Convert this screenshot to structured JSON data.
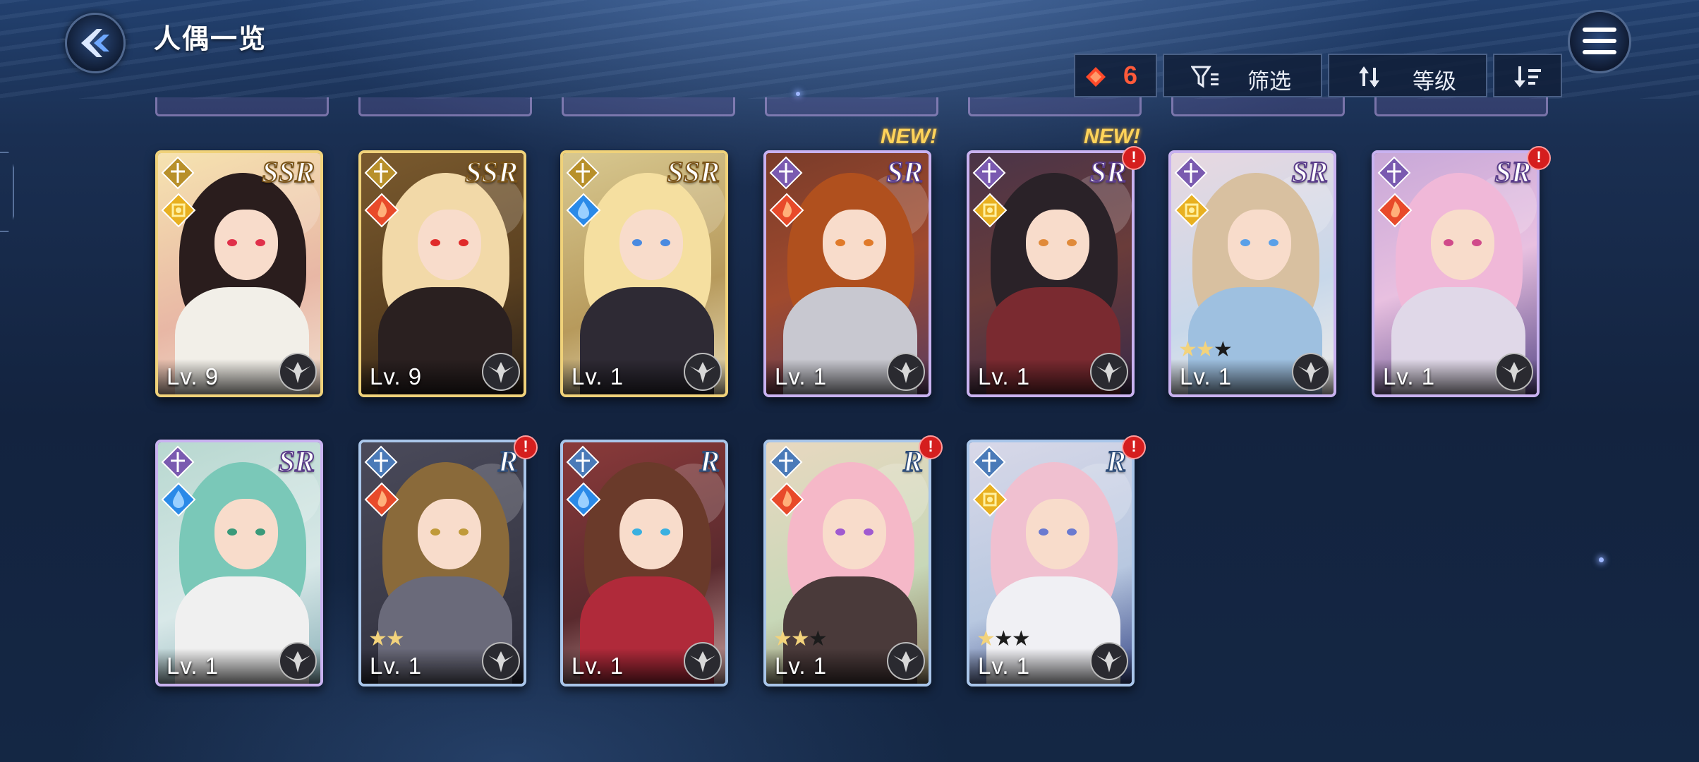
{
  "header": {
    "title": "人偶一览"
  },
  "toolbar": {
    "count": "6",
    "filter_label": "筛选",
    "sort_label": "等级"
  },
  "cards": [
    {
      "rarity": "SSR",
      "level": "Lv. 9",
      "element": "light",
      "stars_on": 0,
      "stars_off": 0,
      "new": false,
      "alert": false
    },
    {
      "rarity": "SSR",
      "level": "Lv. 9",
      "element": "fire",
      "stars_on": 0,
      "stars_off": 0,
      "new": false,
      "alert": false
    },
    {
      "rarity": "SSR",
      "level": "Lv. 1",
      "element": "water",
      "stars_on": 0,
      "stars_off": 0,
      "new": false,
      "alert": false
    },
    {
      "rarity": "SR",
      "level": "Lv. 1",
      "element": "fire",
      "stars_on": 0,
      "stars_off": 0,
      "new": true,
      "alert": false
    },
    {
      "rarity": "SR",
      "level": "Lv. 1",
      "element": "light",
      "stars_on": 0,
      "stars_off": 0,
      "new": true,
      "alert": true
    },
    {
      "rarity": "SR",
      "level": "Lv. 1",
      "element": "light",
      "stars_on": 2,
      "stars_off": 1,
      "new": false,
      "alert": false
    },
    {
      "rarity": "SR",
      "level": "Lv. 1",
      "element": "fire",
      "stars_on": 0,
      "stars_off": 0,
      "new": false,
      "alert": true
    },
    {
      "rarity": "SR",
      "level": "Lv. 1",
      "element": "water",
      "stars_on": 0,
      "stars_off": 0,
      "new": false,
      "alert": false
    },
    {
      "rarity": "R",
      "level": "Lv. 1",
      "element": "fire",
      "stars_on": 2,
      "stars_off": 0,
      "new": false,
      "alert": true
    },
    {
      "rarity": "R",
      "level": "Lv. 1",
      "element": "water",
      "stars_on": 0,
      "stars_off": 0,
      "new": false,
      "alert": false
    },
    {
      "rarity": "R",
      "level": "Lv. 1",
      "element": "fire",
      "stars_on": 2,
      "stars_off": 1,
      "new": false,
      "alert": true
    },
    {
      "rarity": "R",
      "level": "Lv. 1",
      "element": "light",
      "stars_on": 1,
      "stars_off": 2,
      "new": false,
      "alert": true
    }
  ],
  "new_label": "NEW!",
  "alert_symbol": "!",
  "colors": {
    "accent_red": "#ff5a3a",
    "gold": "#f0d27a",
    "purple": "#c9b2f0",
    "blue": "#a9c6ea"
  }
}
